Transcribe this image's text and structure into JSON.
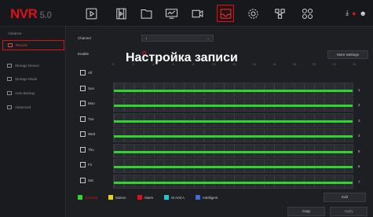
{
  "header": {
    "logo": "NVR",
    "version": "5.0"
  },
  "toolbar": {
    "icons": [
      "play-icon",
      "film-icon",
      "folder-icon",
      "monitor-chart-icon",
      "camera-icon",
      "record-icon",
      "gear-icon",
      "network-icon",
      "grid-icon"
    ],
    "active": "record-icon"
  },
  "sidebar": {
    "section": "Advance",
    "items": [
      {
        "label": "Record",
        "active": true
      },
      {
        "label": "Storage Device",
        "active": false
      },
      {
        "label": "Storage Mode",
        "active": false
      },
      {
        "label": "Auto Backup",
        "active": false
      },
      {
        "label": "Advanced",
        "active": false
      }
    ]
  },
  "main": {
    "channel_label": "Channel",
    "channel_value": "1",
    "enable_label": "Enable",
    "overlay_title": "Настройка записи",
    "more_settings": "More Settings",
    "hour_labels": [
      "0",
      "2",
      "4",
      "6",
      "8",
      "10",
      "12",
      "14",
      "16",
      "18",
      "20",
      "22",
      "24"
    ],
    "rows": [
      {
        "label": "All",
        "num": ""
      },
      {
        "label": "Sun",
        "num": "1"
      },
      {
        "label": "Mon",
        "num": "2"
      },
      {
        "label": "Tue",
        "num": "3"
      },
      {
        "label": "Wed",
        "num": "4"
      },
      {
        "label": "Thu",
        "num": "5"
      },
      {
        "label": "Fri",
        "num": "6"
      },
      {
        "label": "Sat",
        "num": "7"
      }
    ],
    "legend": [
      {
        "label": "General",
        "color": "#2fd52f"
      },
      {
        "label": "Motion",
        "color": "#e6d21c"
      },
      {
        "label": "Alarm",
        "color": "#d8121b"
      },
      {
        "label": "M And A",
        "color": "#1fc7d8"
      },
      {
        "label": "Intelligent",
        "color": "#3a6ed8"
      }
    ],
    "edit_label": "Edit",
    "copy_label": "Copy",
    "apply_label": "Apply"
  }
}
